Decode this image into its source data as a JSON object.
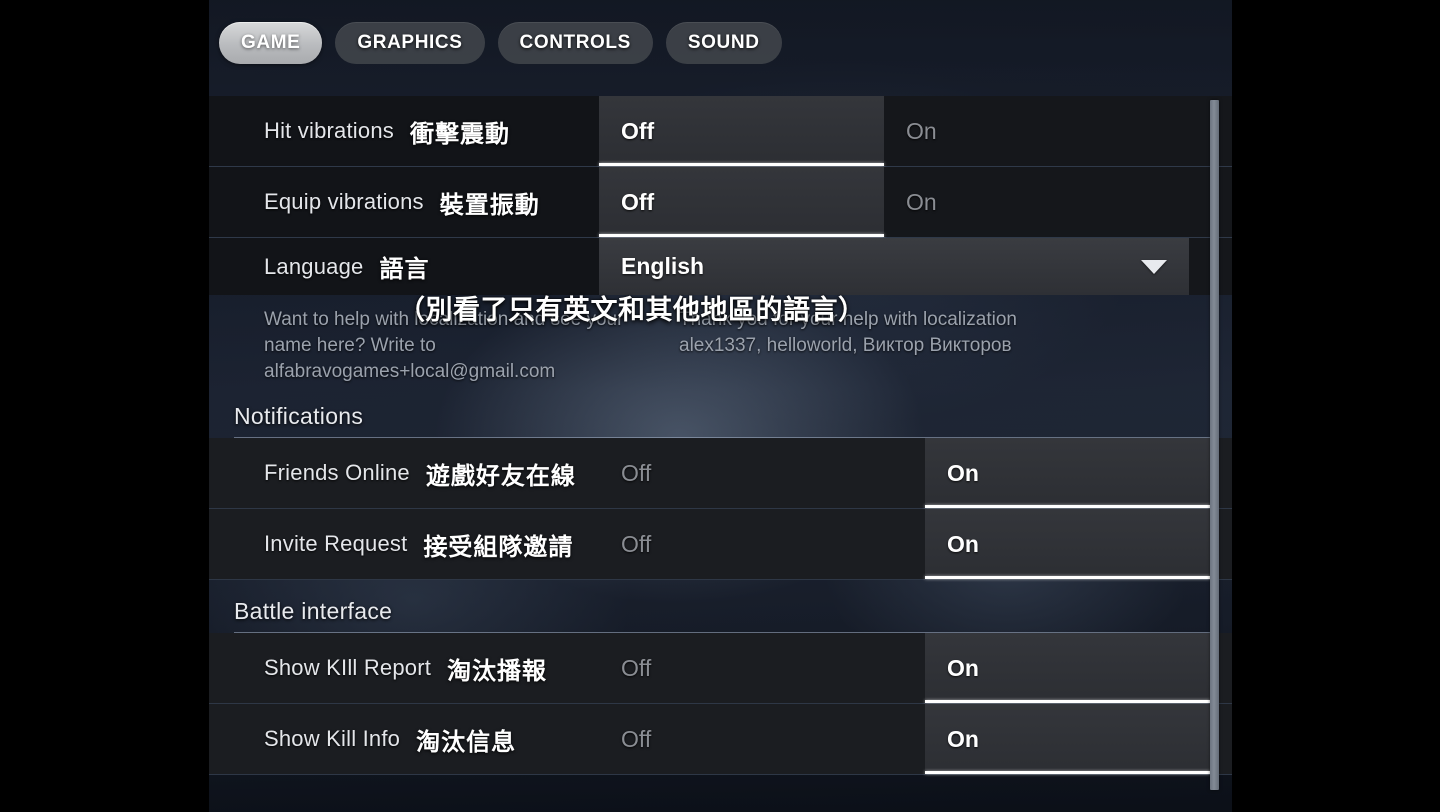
{
  "tabs": [
    {
      "label": "GAME",
      "active": true
    },
    {
      "label": "GRAPHICS",
      "active": false
    },
    {
      "label": "CONTROLS",
      "active": false
    },
    {
      "label": "SOUND",
      "active": false
    }
  ],
  "settings": {
    "hit_vibrations": {
      "label_en": "Hit vibrations",
      "label_zh": "衝擊震動",
      "option_off": "Off",
      "option_on": "On",
      "selected": "Off"
    },
    "equip_vibrations": {
      "label_en": "Equip vibrations",
      "label_zh": "裝置振動",
      "option_off": "Off",
      "option_on": "On",
      "selected": "Off"
    },
    "language": {
      "label_en": "Language",
      "label_zh": "語言",
      "value": "English",
      "arrow_icon": "chevron-down-icon"
    }
  },
  "overlay_note": "（別看了只有英文和其他地區的語言）",
  "localization": {
    "left_text": "Want to help with localization and see your name here? Write to alfabravogames+local@gmail.com",
    "right_text": "Thank you for your help with localization alex1337, helloworld, Виктор Викторов"
  },
  "sections": [
    {
      "title": "Notifications",
      "rows": [
        {
          "label_en": "Friends Online",
          "label_zh": "遊戲好友在線",
          "option_off": "Off",
          "option_on": "On",
          "selected": "On"
        },
        {
          "label_en": "Invite Request",
          "label_zh": "接受組隊邀請",
          "option_off": "Off",
          "option_on": "On",
          "selected": "On"
        }
      ]
    },
    {
      "title": "Battle interface",
      "rows": [
        {
          "label_en": "Show KIll Report",
          "label_zh": "淘汰播報",
          "option_off": "Off",
          "option_on": "On",
          "selected": "On"
        },
        {
          "label_en": "Show Kill Info",
          "label_zh": "淘汰信息",
          "option_off": "Off",
          "option_on": "On",
          "selected": "On"
        }
      ]
    }
  ],
  "colors": {
    "accent_white": "#ffffff",
    "row_bg": "#1b1d21",
    "selected_bg": "#34363b",
    "muted_text": "#8a8d93",
    "help_text": "#9ba2ad"
  }
}
